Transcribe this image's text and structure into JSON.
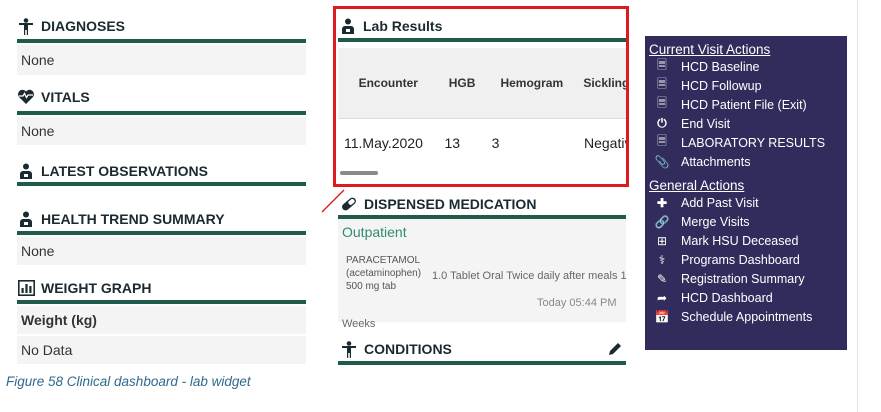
{
  "left": {
    "diagnoses": {
      "title": "DIAGNOSES",
      "value": "None"
    },
    "vitals": {
      "title": "VITALS",
      "value": "None"
    },
    "latest_observations": {
      "title": "LATEST OBSERVATIONS"
    },
    "health_trend": {
      "title": "HEALTH TREND SUMMARY",
      "value": "None"
    },
    "weight_graph": {
      "title": "WEIGHT GRAPH",
      "label": "Weight (kg)",
      "value": "No Data"
    }
  },
  "lab": {
    "title": "Lab Results",
    "headers": [
      "Encounter",
      "HGB",
      "Hemogram",
      "Sickling test"
    ],
    "row": [
      "11.May.2020",
      "13",
      "3",
      "Negativ"
    ]
  },
  "medication": {
    "title": "DISPENSED MEDICATION",
    "type": "Outpatient",
    "drug": "PARACETAMOL (acetaminophen) 500 mg tab",
    "dose": "1.0 Tablet Oral Twice daily after meals 1 Weeks",
    "time": "Today 05:44 PM"
  },
  "conditions": {
    "title": "CONDITIONS"
  },
  "actions": {
    "current_title": "Current Visit Actions",
    "current": [
      {
        "label": "HCD Baseline",
        "icon": "document-icon"
      },
      {
        "label": "HCD Followup",
        "icon": "document-icon"
      },
      {
        "label": "HCD Patient File (Exit)",
        "icon": "document-icon"
      },
      {
        "label": "End Visit",
        "icon": "power-icon"
      },
      {
        "label": "LABORATORY RESULTS",
        "icon": "document-icon"
      },
      {
        "label": "Attachments",
        "icon": "paperclip-icon"
      }
    ],
    "general_title": "General Actions",
    "general": [
      {
        "label": "Add Past Visit",
        "icon": "plus-icon"
      },
      {
        "label": "Merge Visits",
        "icon": "link-icon"
      },
      {
        "label": "Mark HSU Deceased",
        "icon": "plus-square-icon"
      },
      {
        "label": "Programs Dashboard",
        "icon": "stethoscope-icon"
      },
      {
        "label": "Registration Summary",
        "icon": "pencil-icon"
      },
      {
        "label": "HCD Dashboard",
        "icon": "share-icon"
      },
      {
        "label": "Schedule Appointments",
        "icon": "calendar-icon"
      }
    ]
  },
  "caption": "Figure 58 Clinical dashboard - lab widget",
  "colors": {
    "accent": "#1f5a4a",
    "panel": "#312c5c",
    "highlight": "#e0191d",
    "link": "#2f8a72"
  }
}
